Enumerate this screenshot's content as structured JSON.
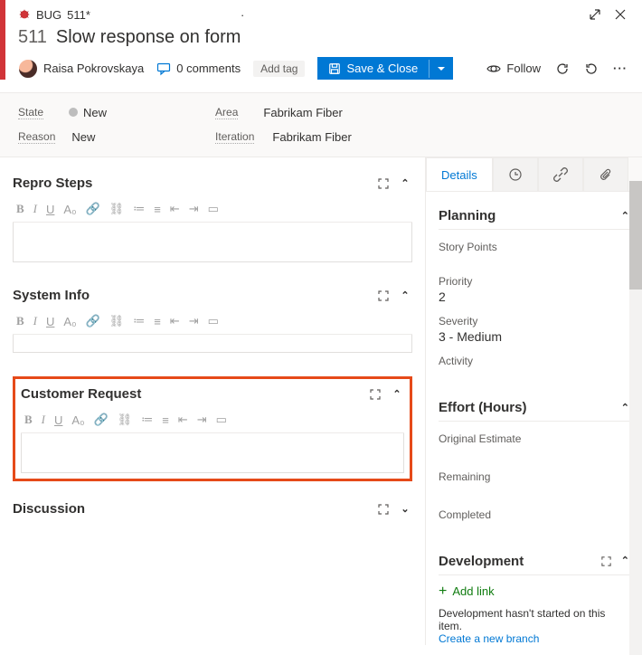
{
  "header": {
    "workitem_type": "BUG",
    "id_with_dirty": "511*",
    "id": "511",
    "title": "Slow response on form"
  },
  "meta": {
    "assignee": "Raisa Pokrovskaya",
    "comments_label": "0 comments",
    "add_tag_label": "Add tag",
    "save_label": "Save & Close",
    "follow_label": "Follow"
  },
  "info": {
    "state_label": "State",
    "state_value": "New",
    "reason_label": "Reason",
    "reason_value": "New",
    "area_label": "Area",
    "area_value": "Fabrikam Fiber",
    "iteration_label": "Iteration",
    "iteration_value": "Fabrikam Fiber"
  },
  "tabs": {
    "details": "Details"
  },
  "planning": {
    "title": "Planning",
    "story_points_label": "Story Points",
    "priority_label": "Priority",
    "priority_value": "2",
    "severity_label": "Severity",
    "severity_value": "3 - Medium",
    "activity_label": "Activity"
  },
  "effort": {
    "title": "Effort (Hours)",
    "original_label": "Original Estimate",
    "remaining_label": "Remaining",
    "completed_label": "Completed"
  },
  "development": {
    "title": "Development",
    "add_link": "Add link",
    "status": "Development hasn't started on this item.",
    "create_branch": "Create a new branch"
  },
  "editors": {
    "repro": "Repro Steps",
    "sysinfo": "System Info",
    "customer_request": "Customer Request",
    "discussion": "Discussion"
  }
}
